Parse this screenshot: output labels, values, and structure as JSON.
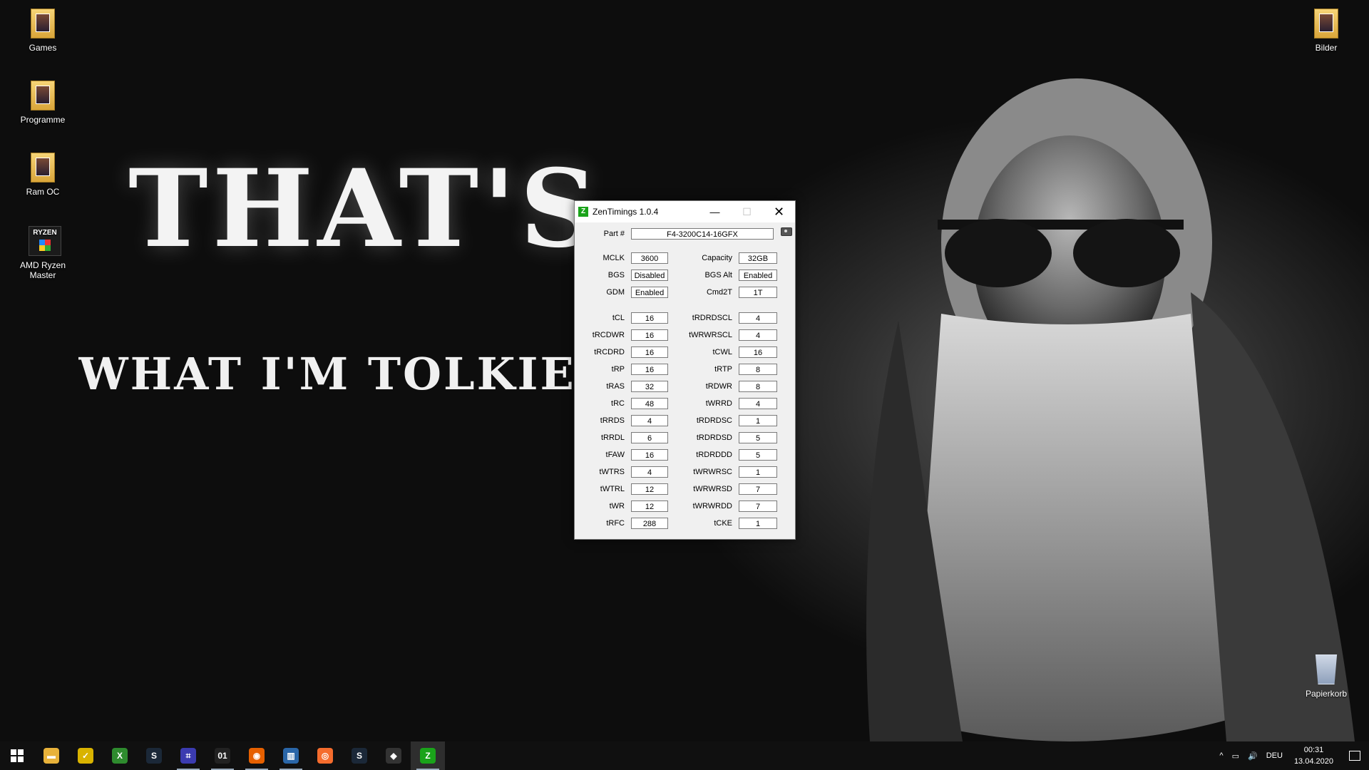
{
  "wallpaper": {
    "title": "THAT'S",
    "subtitle": "WHAT I'M TOLKIEN A"
  },
  "desktop_icons": [
    {
      "label": "Games",
      "icon": "folder-icon"
    },
    {
      "label": "Programme",
      "icon": "folder-icon"
    },
    {
      "label": "Ram OC",
      "icon": "folder-icon"
    },
    {
      "label": "AMD Ryzen Master",
      "icon": "ryzen-master-icon",
      "badge": "RYZEN"
    },
    {
      "label": "Bilder",
      "icon": "folder-icon"
    },
    {
      "label": "Papierkorb",
      "icon": "recycle-bin-icon"
    }
  ],
  "window": {
    "title": "ZenTimings 1.0.4",
    "icon_letter": "Z",
    "minimize": "—",
    "maximize": "☐",
    "close": "✕",
    "part_label": "Part #",
    "part_value": "F4-3200C14-16GFX",
    "top_rows": [
      {
        "l1": "MCLK",
        "v1": "3600",
        "l2": "Capacity",
        "v2": "32GB"
      },
      {
        "l1": "BGS",
        "v1": "Disabled",
        "l2": "BGS Alt",
        "v2": "Enabled"
      },
      {
        "l1": "GDM",
        "v1": "Enabled",
        "l2": "Cmd2T",
        "v2": "1T"
      }
    ],
    "timing_rows": [
      {
        "l1": "tCL",
        "v1": "16",
        "l2": "tRDRDSCL",
        "v2": "4"
      },
      {
        "l1": "tRCDWR",
        "v1": "16",
        "l2": "tWRWRSCL",
        "v2": "4"
      },
      {
        "l1": "tRCDRD",
        "v1": "16",
        "l2": "tCWL",
        "v2": "16"
      },
      {
        "l1": "tRP",
        "v1": "16",
        "l2": "tRTP",
        "v2": "8"
      },
      {
        "l1": "tRAS",
        "v1": "32",
        "l2": "tRDWR",
        "v2": "8"
      },
      {
        "l1": "tRC",
        "v1": "48",
        "l2": "tWRRD",
        "v2": "4"
      },
      {
        "l1": "tRRDS",
        "v1": "4",
        "l2": "tRDRDSC",
        "v2": "1"
      },
      {
        "l1": "tRRDL",
        "v1": "6",
        "l2": "tRDRDSD",
        "v2": "5"
      },
      {
        "l1": "tFAW",
        "v1": "16",
        "l2": "tRDRDDD",
        "v2": "5"
      },
      {
        "l1": "tWTRS",
        "v1": "4",
        "l2": "tWRWRSC",
        "v2": "1"
      },
      {
        "l1": "tWTRL",
        "v1": "12",
        "l2": "tWRWRSD",
        "v2": "7"
      },
      {
        "l1": "tWR",
        "v1": "12",
        "l2": "tWRWRDD",
        "v2": "7"
      },
      {
        "l1": "tRFC",
        "v1": "288",
        "l2": "tCKE",
        "v2": "1"
      }
    ]
  },
  "taskbar": {
    "start_icon": "windows-start-icon",
    "apps": [
      {
        "name": "file-explorer-icon",
        "color": "#e8b23a",
        "glyph": "▬"
      },
      {
        "name": "checklist-app-icon",
        "color": "#d9b300",
        "glyph": "✓"
      },
      {
        "name": "xbox-icon",
        "color": "#2e8b2e",
        "glyph": "X"
      },
      {
        "name": "steam-icon",
        "color": "#1b2838",
        "glyph": "S"
      },
      {
        "name": "cpu-app-icon",
        "color": "#3b3bb0",
        "glyph": "⌗"
      },
      {
        "name": "binary-app-icon",
        "color": "#222222",
        "glyph": "01"
      },
      {
        "name": "firefox-icon",
        "color": "#e66000",
        "glyph": "◉"
      },
      {
        "name": "memory-app-icon",
        "color": "#2a66a8",
        "glyph": "▥"
      },
      {
        "name": "origin-icon",
        "color": "#f56c2d",
        "glyph": "◎"
      },
      {
        "name": "steam-icon-2",
        "color": "#1b2838",
        "glyph": "S"
      },
      {
        "name": "amd-app-icon",
        "color": "#333333",
        "glyph": "◆"
      },
      {
        "name": "zentimings-taskbar-icon",
        "color": "#1aa31a",
        "glyph": "Z"
      }
    ],
    "tray": {
      "chevron": "^",
      "network": "▭",
      "volume": "🔊",
      "language": "DEU",
      "time": "00:31",
      "date": "13.04.2020"
    }
  }
}
